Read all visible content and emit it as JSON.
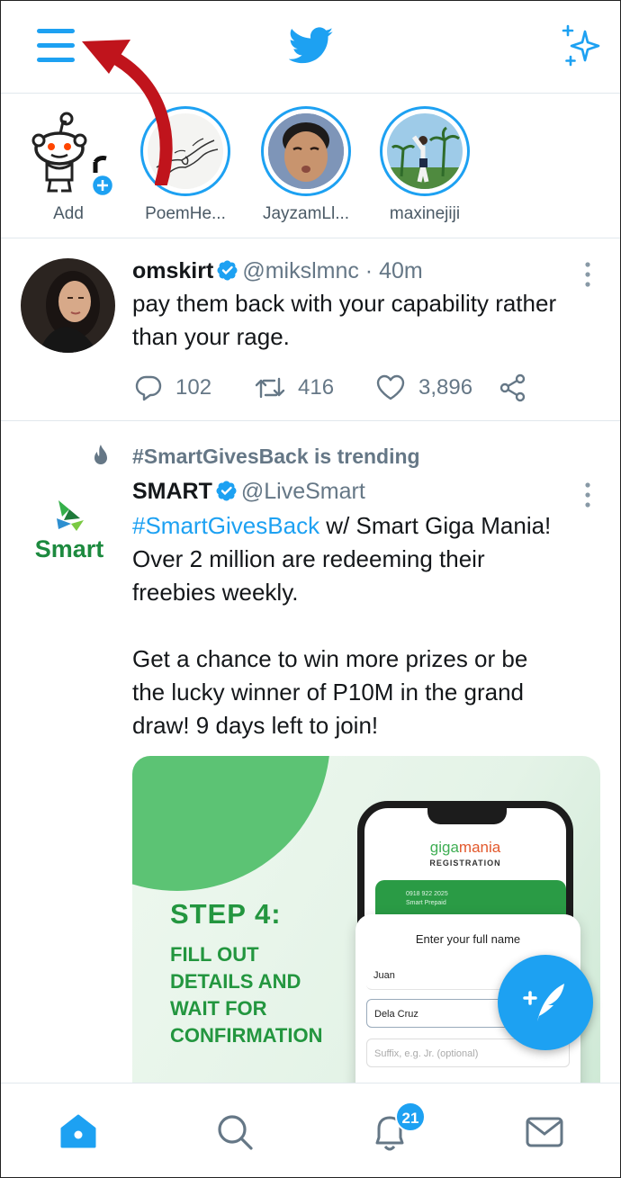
{
  "fleets": [
    {
      "label": "Add"
    },
    {
      "label": "PoemHe..."
    },
    {
      "label": "JayzamLl..."
    },
    {
      "label": "maxinejiji"
    }
  ],
  "tweet1": {
    "name": "omskirt",
    "handle": "@mikslmnc",
    "time": "40m",
    "text_line1": "pay them back with your capability rather",
    "text_line2": "than your rage.",
    "replies": "102",
    "retweets": "416",
    "likes": "3,896"
  },
  "tweet2": {
    "trending": "#SmartGivesBack is trending",
    "name": "SMART",
    "handle": "@LiveSmart",
    "logo_text": "Smart",
    "hashtag": "#SmartGivesBack",
    "line1_rest": " w/ Smart Giga Mania!",
    "line2": "Over 2 million are redeeming their",
    "line3": "freebies weekly.",
    "line4": "Get a chance to win more prizes or be",
    "line5": "the lucky winner of P10M in the grand",
    "line6": "draw! 9 days left to join!",
    "media": {
      "step_title": "STEP 4:",
      "step_lines": [
        "FILL OUT",
        "DETAILS AND",
        "WAIT FOR",
        "CONFIRMATION"
      ],
      "app_name_a": "giga",
      "app_name_b": "mania",
      "registration": "REGISTRATION",
      "card_number": "0918 922 2025",
      "card_sub": "Smart Prepaid",
      "form_title": "Enter your full name",
      "first_name": "Juan",
      "last_name": "Dela Cruz",
      "suffix_placeholder": "Suffix, e.g. Jr. (optional)"
    }
  },
  "notifications_badge": "21",
  "colors": {
    "brand_blue": "#1da1f2",
    "annotation_arrow": "#c0141c",
    "smart_green": "#23963f"
  }
}
